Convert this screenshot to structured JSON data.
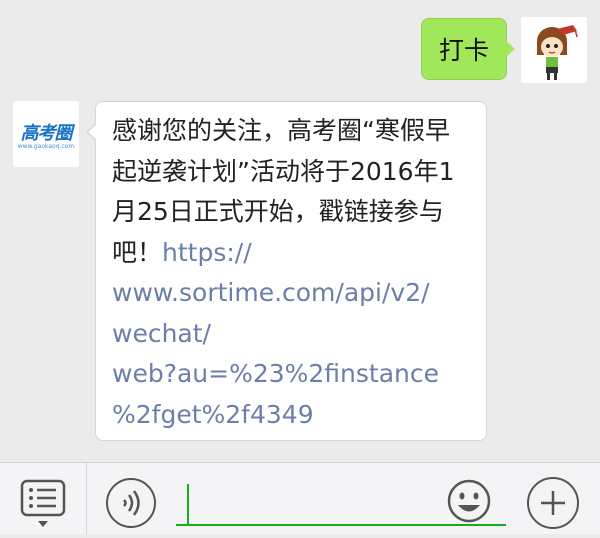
{
  "messages": {
    "outgoing": {
      "text": "打卡"
    },
    "incoming": {
      "lines": [
        "感谢您的关注，高考圈“寒假早",
        "起逆袭计划”活动将于2016年1",
        "月25日正式开始，戳链接参与",
        "吧！"
      ],
      "link_lines": [
        "https://",
        "www.sortime.com/api/v2/",
        "wechat/",
        "web?au=%23%2finstance",
        "%2fget%2f4349"
      ]
    }
  },
  "sender": {
    "logo_text": "高考圈",
    "logo_url": "www.gaokaoq.com"
  },
  "colors": {
    "outgoing_bubble": "#a0e85a",
    "link": "#6b7fa8",
    "input_accent": "#1aad19"
  },
  "icons": [
    "menu-list-icon",
    "voice-icon",
    "emoji-icon",
    "plus-icon"
  ]
}
